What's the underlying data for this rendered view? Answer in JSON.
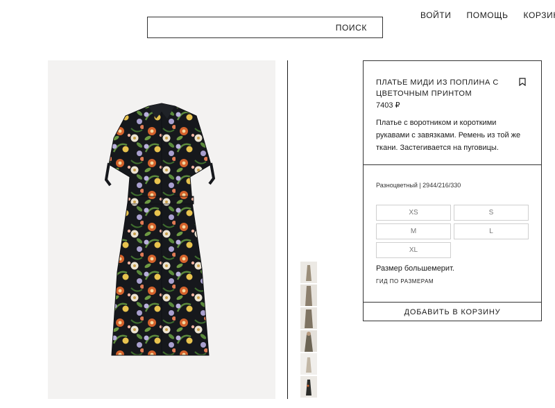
{
  "header": {
    "search_label": "ПОИСК",
    "nav": [
      "ВОЙТИ",
      "ПОМОЩЬ",
      "КОРЗИНА ("
    ]
  },
  "product": {
    "title": "ПЛАТЬЕ МИДИ ИЗ ПОПЛИНА С ЦВЕТОЧНЫМ ПРИНТОМ",
    "price": "7403 ₽",
    "description": "Платье с воротником и короткими рукавами с завязками. Ремень из той же ткани. Застегивается на пуговицы.",
    "color_ref": "Разноцветный | 2944/216/330",
    "sizes": [
      "XS",
      "S",
      "M",
      "L",
      "XL"
    ],
    "fit_note": "Размер большемерит.",
    "size_guide": "ГИД ПО РАЗМЕРАМ",
    "add_to_cart": "ДОБАВИТЬ В КОРЗИНУ"
  },
  "colors": {
    "dress_base": "#16181c",
    "accent_orange": "#d4622b",
    "accent_yellow": "#e8c34e",
    "accent_lilac": "#a9a0cf",
    "accent_green": "#5b8a3c",
    "image_bg": "#f3f2f1"
  },
  "icons": {
    "bookmark": "bookmark-icon"
  }
}
